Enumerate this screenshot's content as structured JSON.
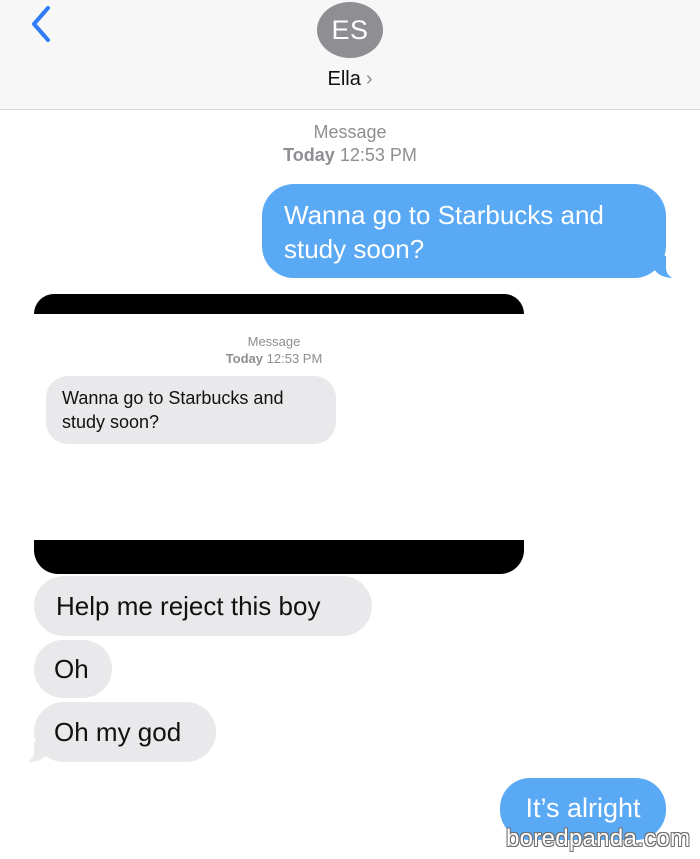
{
  "header": {
    "avatar_initials": "ES",
    "contact_name": "Ella",
    "chevron": "›",
    "back_icon": "chevron-left-icon",
    "accent_color": "#2f7cf6"
  },
  "thread": {
    "timestamp_label": "Message",
    "timestamp_day": "Today",
    "timestamp_time": "12:53 PM",
    "sent_1": "Wanna go to Starbucks and\nstudy soon?",
    "embedded_screenshot": {
      "timestamp_label": "Message",
      "timestamp_day": "Today",
      "timestamp_time": "12:53 PM",
      "received": "Wanna go to Starbucks and\nstudy soon?"
    },
    "received_1": "Help me reject this boy",
    "received_2": "Oh",
    "received_3": "Oh my god",
    "sent_2": "It’s alright"
  },
  "colors": {
    "sent_bubble": "#5aa9f5",
    "received_bubble": "#e9e9eb",
    "header_bg": "#f7f7f7",
    "avatar_bg": "#8e8e93"
  },
  "watermark": "boredpanda.com"
}
